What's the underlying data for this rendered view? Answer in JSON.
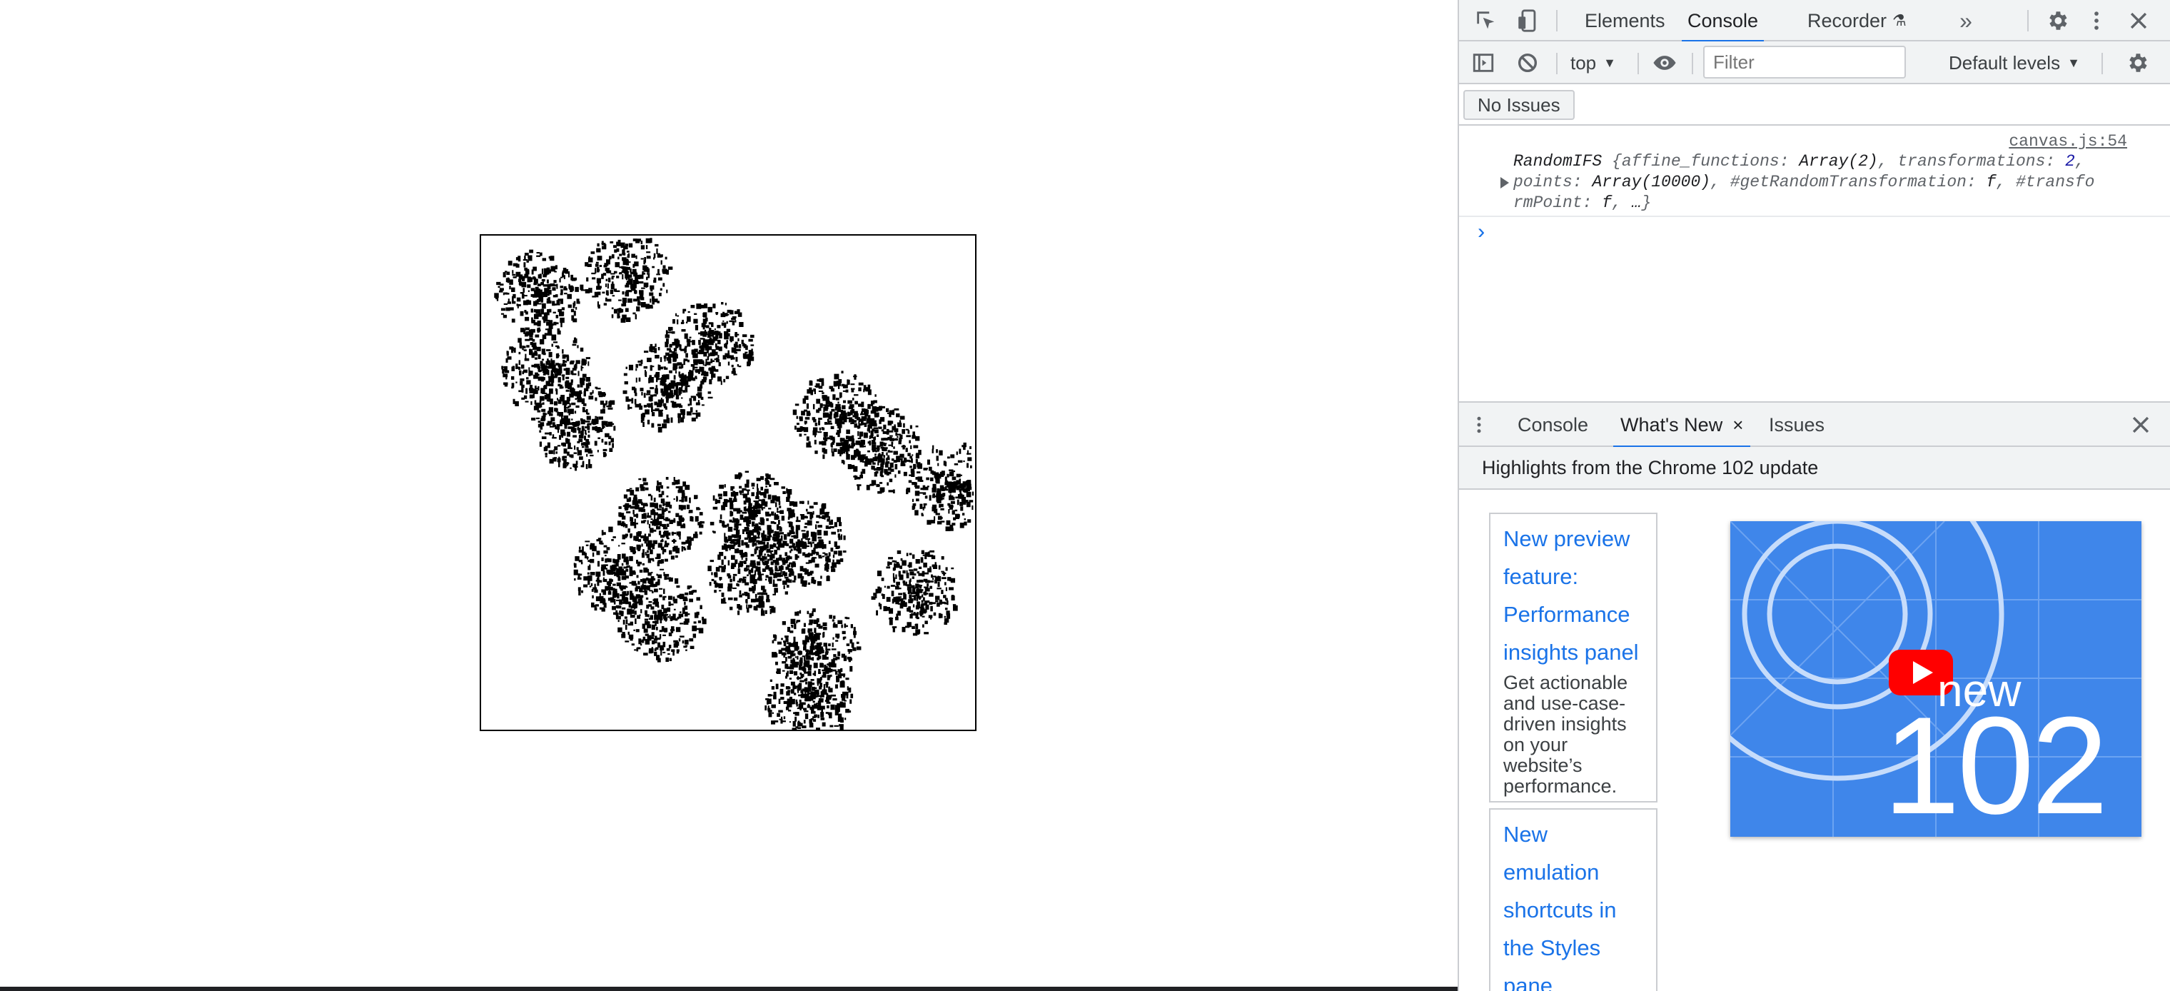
{
  "devtools": {
    "main_tabs": [
      "Elements",
      "Console",
      "Recorder"
    ],
    "active_main_tab": "Console",
    "toolbar": {
      "context": "top",
      "filter_placeholder": "Filter",
      "levels": "Default levels"
    },
    "issues_button": "No Issues",
    "console": {
      "message_source": "canvas.js:54",
      "message": {
        "class_name": "RandomIFS",
        "affine_key": "affine_functions",
        "affine_val": "Array(2)",
        "transformations_key": "transformations",
        "transformations_val": "2",
        "points_key": "points",
        "points_val": "Array(10000)",
        "random_key": "#getRandomTransformation",
        "fn_val": "f",
        "transform_key_part1": "#transfo",
        "transform_key_part2": "rmPoint",
        "ellipsis": "…"
      },
      "prompt": "›"
    },
    "drawer": {
      "tabs": [
        "Console",
        "What's New",
        "Issues"
      ],
      "active_tab": "What's New",
      "close_label": "×",
      "highlights_title": "Highlights from the Chrome 102 update",
      "cards": [
        {
          "title_lines": [
            "New preview",
            "feature:",
            "Performance",
            "insights panel"
          ],
          "description_lines": [
            "Get actionable",
            "and use-case-",
            "driven insights",
            "on your",
            "website’s",
            "performance."
          ]
        },
        {
          "title_lines": [
            "New",
            "emulation",
            "shortcuts in",
            "the Styles",
            "pane"
          ]
        }
      ],
      "video": {
        "badge_text": "new",
        "version": "102"
      }
    }
  },
  "colors": {
    "accent": "#1a73e8",
    "toolbar_bg": "#f1f3f4",
    "video_bg": "#3f86ea",
    "play_button": "#ff0000"
  }
}
